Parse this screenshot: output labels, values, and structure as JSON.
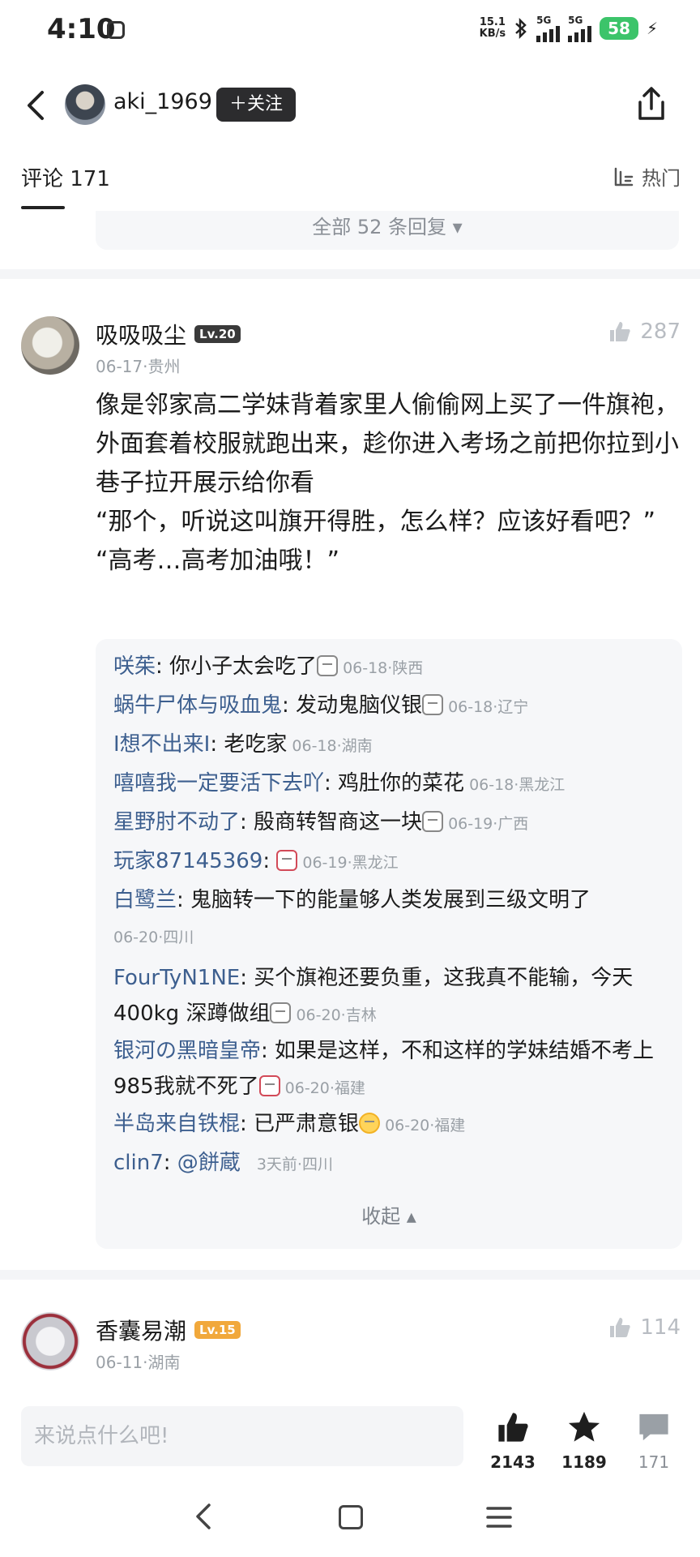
{
  "status": {
    "time": "4:10",
    "net_speed_value": "15.1",
    "net_speed_unit": "KB/s",
    "sim1": "5G",
    "sim2": "5G",
    "battery": "58"
  },
  "header": {
    "username": "aki_1969",
    "follow_label": "＋关注"
  },
  "tabs": {
    "comments_label": "评论 171",
    "sort_label": "热门"
  },
  "prev_thread": {
    "replies_toggle": "全部 52 条回复 ▾"
  },
  "comments": [
    {
      "name": "吸吸吸尘",
      "level": "Lv.20",
      "date": "06-17",
      "location": "贵州",
      "likes": "287",
      "text": "像是邻家高二学妹背着家里人偷偷网上买了一件旗袍，外面套着校服就跑出来，趁你进入考场之前把你拉到小巷子拉开展示给你看\n“那个，听说这叫旗开得胜，怎么样？应该好看吧？”\n“高考…高考加油哦！”",
      "replies": [
        {
          "name": "咲茱",
          "text": "你小子太会吃了",
          "meta": "06-18·陕西"
        },
        {
          "name": "蜗牛尸体与吸血鬼",
          "text": "发动鬼脑仪银",
          "meta": "06-18·辽宁"
        },
        {
          "name": "I想不出来I",
          "text": "老吃家",
          "meta": "06-18·湖南"
        },
        {
          "name": "嘻嘻我一定要活下去吖",
          "text": "鸡肚你的菜花",
          "meta": "06-18·黑龙江"
        },
        {
          "name": "星野肘不动了",
          "text": "殷商转智商这一块",
          "meta": "06-19·广西"
        },
        {
          "name": "玩家87145369",
          "text": "",
          "meta": "06-19·黑龙江"
        },
        {
          "name": "白鹭兰",
          "text": "鬼脑转一下的能量够人类发展到三级文明了",
          "meta": "06-20·四川"
        },
        {
          "name": "FourTyN1NE",
          "text": "买个旗袍还要负重，这我真不能输，今天400kg 深蹲做组",
          "meta": "06-20·吉林"
        },
        {
          "name": "银河の黑暗皇帝",
          "text": "如果是这样，不和这样的学妹结婚不考上985我就不死了",
          "meta": "06-20·福建"
        },
        {
          "name": "半岛来自铁棍",
          "text": "已严肃意银",
          "meta": "06-20·福建"
        },
        {
          "name": "clin7",
          "text": "@餅蔵",
          "meta": "3天前·四川"
        }
      ],
      "collapse_label": "收起 ▴"
    },
    {
      "name": "香囊易潮",
      "level": "Lv.15",
      "date": "06-11",
      "location": "湖南",
      "likes": "114"
    }
  ],
  "bottom": {
    "input_placeholder": "来说点什么吧!",
    "likes": "2143",
    "favorites": "1189",
    "comments": "171"
  }
}
